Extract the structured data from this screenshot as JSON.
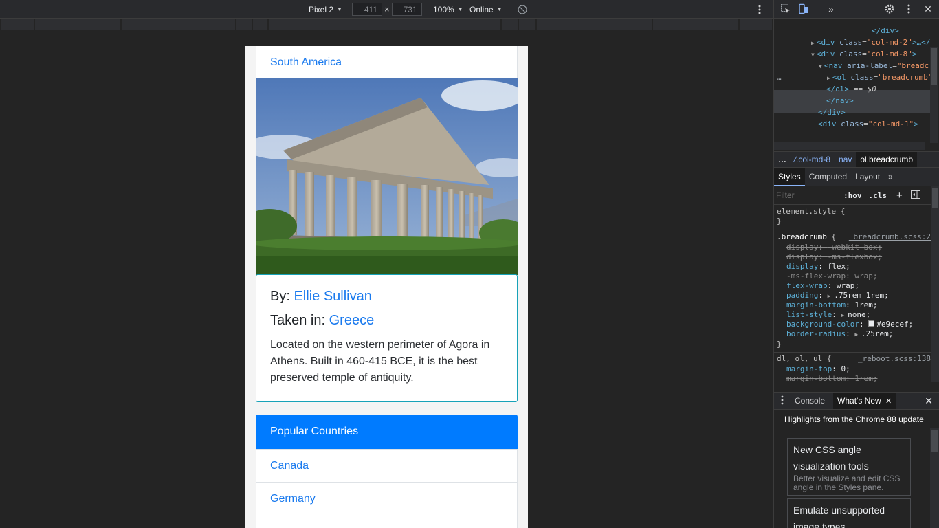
{
  "device_toolbar": {
    "device": "Pixel 2",
    "width": "411",
    "height": "731",
    "zoom": "100%",
    "throttle": "Online",
    "x_sep": "×"
  },
  "page": {
    "region_link": "South America",
    "photo_card": {
      "by_label": "By:",
      "author": "Ellie Sullivan",
      "taken_label": "Taken in:",
      "country": "Greece",
      "description": "Located on the western perimeter of Agora in Athens. Built in 460-415 BCE, it is the best preserved temple of antiquity."
    },
    "popular": {
      "header": "Popular Countries",
      "items": [
        "Canada",
        "Germany"
      ]
    }
  },
  "devtools": {
    "dom": {
      "line1_close": "</div>",
      "line2": {
        "tag": "div",
        "attr": "class",
        "val": "\"col-md-2\"",
        "tail": ">…</"
      },
      "line3": {
        "tag": "div",
        "attr": "class",
        "val": "\"col-md-8\"",
        "tail": ">"
      },
      "line4": {
        "tag": "nav",
        "attr": "aria-label",
        "val": "\"breadc"
      },
      "line5": {
        "tag": "ol",
        "attr": "class",
        "val": "\"breadcrumb\""
      },
      "line6_close": "</ol>",
      "line6_eq": " == $0",
      "line7_close": "</nav>",
      "line8_close": "</div>",
      "line9": {
        "tag": "div",
        "attr": "class",
        "val": "\"col-md-1\"",
        "tail": ">"
      },
      "ellipsis": "…"
    },
    "breadcrumbs": [
      "…",
      "⁄.col-md-8",
      "nav",
      "ol.breadcrumb"
    ],
    "styles_tabs": [
      "Styles",
      "Computed",
      "Layout",
      "»"
    ],
    "filter": {
      "placeholder": "Filter",
      "hov": ":hov",
      "cls": ".cls",
      "plus": "+"
    },
    "css": {
      "element_style": "element.style {",
      "close": "}",
      "breadcrumb_selector": ".breadcrumb",
      "breadcrumb_open": " {",
      "breadcrumb_src": "_breadcrumb.scss:2",
      "props": [
        {
          "name": "display",
          "value": "-webkit-box;",
          "struck": true
        },
        {
          "name": "display",
          "value": "-ms-flexbox;",
          "struck": true
        },
        {
          "name": "display",
          "value": "flex;",
          "struck": false
        },
        {
          "name": "-ms-flex-wrap",
          "value": "wrap;",
          "struck": true
        },
        {
          "name": "flex-wrap",
          "value": "wrap;",
          "struck": false
        },
        {
          "name": "padding",
          "value": ".75rem 1rem;",
          "struck": false,
          "expand": true
        },
        {
          "name": "margin-bottom",
          "value": "1rem;",
          "struck": false
        },
        {
          "name": "list-style",
          "value": "none;",
          "struck": false,
          "expand": true
        },
        {
          "name": "background-color",
          "value": "#e9ecef;",
          "struck": false,
          "swatch": "#e9ecef"
        },
        {
          "name": "border-radius",
          "value": ".25rem;",
          "struck": false,
          "expand": true
        }
      ],
      "reboot_selector": "dl, ol, ul {",
      "reboot_src": "_reboot.scss:138",
      "reboot_props": [
        {
          "name": "margin-top",
          "value": "0;",
          "struck": false
        },
        {
          "name": "margin-bottom",
          "value": "1rem;",
          "struck": true
        }
      ]
    },
    "drawer": {
      "tabs": [
        "Console",
        "What's New"
      ],
      "title": "Highlights from the Chrome 88 update",
      "cards": [
        {
          "head": "New CSS angle visualization tools",
          "sub": "Better visualize and edit CSS angle in the Styles pane."
        },
        {
          "head": "Emulate unsupported image types",
          "sub": ""
        }
      ]
    }
  },
  "colors": {
    "link": "#1a7aee",
    "primary": "#007bff",
    "card_border": "#17a2b8",
    "devtools_bg": "#242424"
  }
}
